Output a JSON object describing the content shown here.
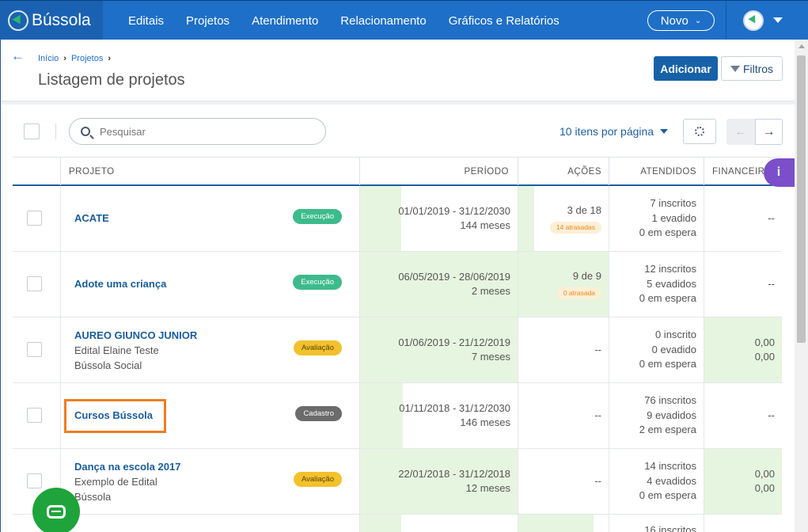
{
  "brand": {
    "name": "Bússola"
  },
  "nav": {
    "links": [
      "Editais",
      "Projetos",
      "Atendimento",
      "Relacionamento",
      "Gráficos e Relatórios"
    ],
    "novo_label": "Novo"
  },
  "breadcrumb": {
    "items": [
      "Início",
      "Projetos"
    ]
  },
  "page": {
    "title": "Listagem de projetos",
    "add_label": "Adicionar",
    "filter_label": "Filtros"
  },
  "toolbar": {
    "search_placeholder": "Pesquisar",
    "per_page_label": "10 itens por página"
  },
  "table": {
    "columns": [
      "PROJETO",
      "PERÍODO",
      "AÇÕES",
      "ATENDIDOS",
      "FINANCEIR"
    ],
    "rows": [
      {
        "name": "ACATE",
        "sub1": "",
        "sub2": "",
        "status": "Execução",
        "period": "01/01/2019 - 31/12/2030",
        "months": "144 meses",
        "actions": "3 de 18",
        "late": "14 atrasadas",
        "att1": "7 inscritos",
        "att2": "1 evadido",
        "att3": "0 em espera",
        "fin1": "--",
        "fin2": ""
      },
      {
        "name": "Adote uma criança",
        "sub1": "",
        "sub2": "",
        "status": "Execução",
        "period": "06/05/2019 - 28/06/2019",
        "months": "2 meses",
        "actions": "9 de 9",
        "late": "0 atrasada",
        "att1": "12 inscritos",
        "att2": "5 evadidos",
        "att3": "0 em espera",
        "fin1": "--",
        "fin2": ""
      },
      {
        "name": "AUREO GIUNCO JUNIOR",
        "sub1": "Edital Elaine Teste",
        "sub2": "Bússola Social",
        "status": "Avaliação",
        "period": "01/06/2019 - 21/12/2019",
        "months": "7 meses",
        "actions": "--",
        "late": "",
        "att1": "0 inscrito",
        "att2": "0 evadido",
        "att3": "0 em espera",
        "fin1": "0,00",
        "fin2": "0,00"
      },
      {
        "name": "Cursos Bússola",
        "sub1": "",
        "sub2": "",
        "status": "Cadastro",
        "period": "01/11/2018 - 31/12/2030",
        "months": "146 meses",
        "actions": "--",
        "late": "",
        "att1": "76 inscritos",
        "att2": "9 evadidos",
        "att3": "2 em espera",
        "fin1": "--",
        "fin2": ""
      },
      {
        "name": "Dança na escola 2017",
        "sub1": "Exemplo de Edital",
        "sub2": "Bússola",
        "status": "Avaliação",
        "period": "22/01/2018 - 31/12/2018",
        "months": "12 meses",
        "actions": "--",
        "late": "",
        "att1": "14 inscritos",
        "att2": "4 evadidos",
        "att3": "0 em espera",
        "fin1": "0,00",
        "fin2": "0,00"
      },
      {
        "name": "",
        "sub1": "",
        "sub2": "",
        "status": "",
        "period": "",
        "months": "",
        "actions": "",
        "late": "",
        "att1": "16 inscritos",
        "att2": "",
        "att3": "",
        "fin1": "",
        "fin2": ""
      }
    ]
  },
  "colors": {
    "nav": "#1e6fc7",
    "execucao": "#3dbb8c",
    "avaliacao": "#f2c12e",
    "cadastro": "#6b6b6b",
    "highlight": "#ef7d22",
    "info": "#7a4fc9",
    "chat": "#1fa33b"
  },
  "icons": [
    "back-arrow-icon",
    "search-icon",
    "gear-icon",
    "filter-icon",
    "info-icon",
    "chat-icon"
  ]
}
